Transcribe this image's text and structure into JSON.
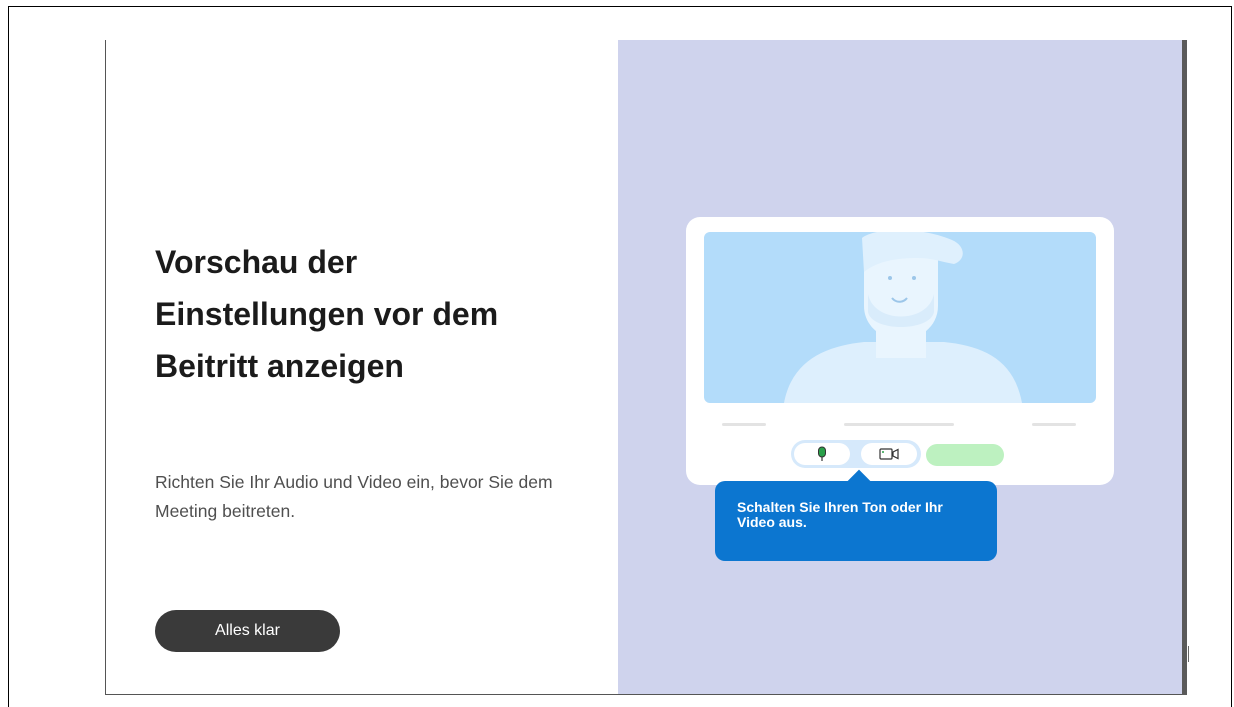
{
  "dialog": {
    "title": "Vorschau der Einstellungen vor dem Beitritt anzeigen",
    "subtitle": "Richten Sie Ihr Audio und Video ein, bevor Sie dem Meeting beitreten.",
    "got_it_label": "Alles klar"
  },
  "illustration": {
    "tooltip_text": "Schalten Sie Ihren Ton oder Ihr Video aus.",
    "icons": [
      "microphone-icon",
      "video-camera-icon"
    ]
  },
  "colors": {
    "right_pane": "#cfd3ed",
    "tooltip": "#0c76d0",
    "button": "#3a3a3a",
    "video_bg": "#b3dcfa",
    "join_pill": "#bdf1c0"
  }
}
